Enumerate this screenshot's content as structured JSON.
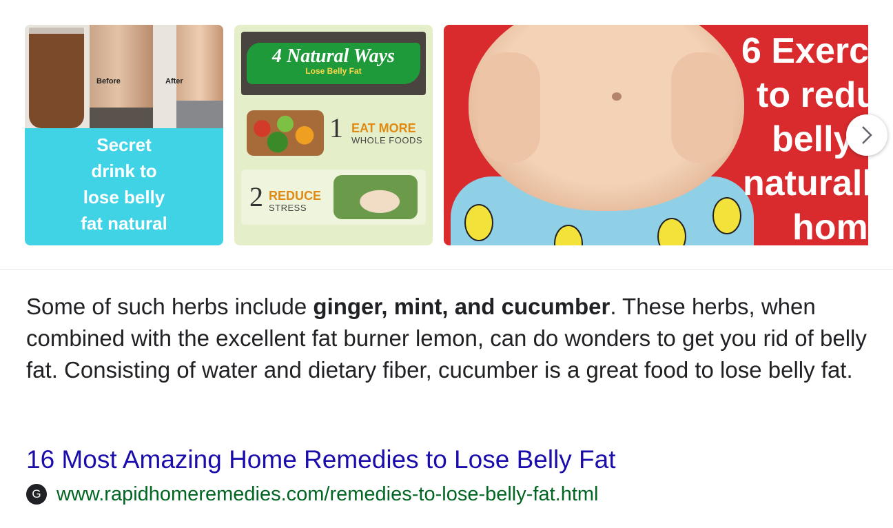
{
  "carousel": {
    "items": [
      {
        "before_label": "Before",
        "after_label": "After",
        "caption_lines": [
          "Secret",
          "drink to",
          "lose belly",
          "fat natural"
        ]
      },
      {
        "title": "4 Natural Ways",
        "subtitle": "Lose Belly Fat",
        "steps": [
          {
            "number": "1",
            "line1": "EAT MORE",
            "line2": "WHOLE FOODS"
          },
          {
            "number": "2",
            "line1": "REDUCE",
            "line2": "STRESS"
          }
        ]
      },
      {
        "text_lines": [
          "6 Exerc",
          "to redu",
          "belly",
          "naturall",
          "hom"
        ]
      }
    ],
    "next_icon": "chevron-right-icon"
  },
  "snippet": {
    "before": "Some of such herbs include ",
    "bold": "ginger, mint, and cucumber",
    "after": ". These herbs, when combined with the excellent fat burner lemon, can do wonders to get you rid of belly fat. Consisting of water and dietary fiber, cucumber is a great food to lose belly fat."
  },
  "result": {
    "title": "16 Most Amazing Home Remedies to Lose Belly Fat",
    "favicon_letter": "G",
    "url": "www.rapidhomeremedies.com/remedies-to-lose-belly-fat.html"
  },
  "colors": {
    "link": "#1a0dab",
    "url": "#006621",
    "text": "#202124"
  }
}
